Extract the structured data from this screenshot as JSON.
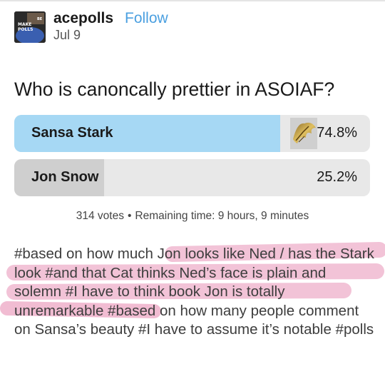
{
  "post": {
    "blog_name": "acepolls",
    "follow_label": "Follow",
    "date": "Jul 9",
    "avatar_text": [
      "MAKE",
      "POLLS",
      "BE"
    ]
  },
  "poll": {
    "question": "Who is canoncally prettier in ASOIAF?",
    "options": [
      {
        "label": "Sansa Stark",
        "percent_label": "74.8%",
        "percent": 74.8,
        "selected": true
      },
      {
        "label": "Jon Snow",
        "percent_label": "25.2%",
        "percent": 25.2,
        "selected": false
      }
    ],
    "votes": "314 votes",
    "remaining": "Remaining time: 9 hours, 9 minutes"
  },
  "tags": [
    "#based on how much",
    "Jon looks like Ned / has the Stark look",
    "#and that",
    "Cat thinks Ned’s face is plain and solemn",
    "#I have to think book Jon is totally unremarkable",
    "#based on how many people comment on Sansa’s beauty",
    "#I have to assume it’s notable",
    "#polls"
  ],
  "colors": {
    "fill_selected": "#a6d8f4",
    "fill_other": "#cfcfcf",
    "option_bg": "#e8e8e8",
    "follow": "#4a9fe0",
    "highlighter": "#e37aa6"
  },
  "icons": {
    "pin": "pin-icon",
    "bullet": "dot-separator-icon"
  }
}
